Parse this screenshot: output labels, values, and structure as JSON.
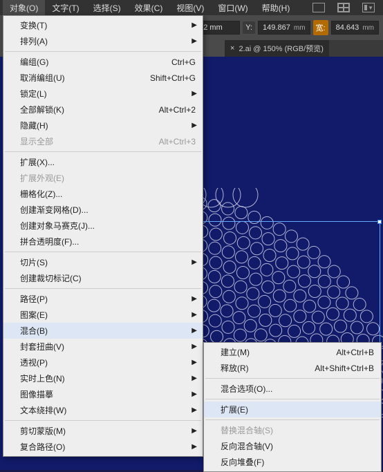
{
  "menubar": {
    "items": [
      "对象(O)",
      "文字(T)",
      "选择(S)",
      "效果(C)",
      "视图(V)",
      "窗口(W)",
      "帮助(H)"
    ]
  },
  "options": {
    "x_suffix": "2 mm",
    "y_label": "Y:",
    "y_value": "149.867",
    "w_label": "宽:",
    "w_value": "84.643",
    "mm": "mm"
  },
  "tabs": {
    "active": {
      "label": "2.ai @ 150% (RGB/预览)",
      "close": "×"
    }
  },
  "menu": {
    "transform": "变换(T)",
    "arrange": "排列(A)",
    "group": "编组(G)",
    "group_sc": "Ctrl+G",
    "ungroup": "取消编组(U)",
    "ungroup_sc": "Shift+Ctrl+G",
    "lock": "锁定(L)",
    "unlockall": "全部解锁(K)",
    "unlockall_sc": "Alt+Ctrl+2",
    "hide": "隐藏(H)",
    "showall": "显示全部",
    "showall_sc": "Alt+Ctrl+3",
    "expand": "扩展(X)...",
    "expandapp": "扩展外观(E)",
    "rasterize": "栅格化(Z)...",
    "gradmesh": "创建渐变网格(D)...",
    "mosaic": "创建对象马赛克(J)...",
    "flatten": "拼合透明度(F)...",
    "slice": "切片(S)",
    "trim": "创建裁切标记(C)",
    "path": "路径(P)",
    "pattern": "图案(E)",
    "blend": "混合(B)",
    "envelope": "封套扭曲(V)",
    "perspective": "透视(P)",
    "livepaint": "实时上色(N)",
    "imgtrace": "图像描摹",
    "textwrap": "文本绕排(W)",
    "clip": "剪切蒙版(M)",
    "compound": "复合路径(O)"
  },
  "submenu": {
    "make": "建立(M)",
    "make_sc": "Alt+Ctrl+B",
    "release": "释放(R)",
    "release_sc": "Alt+Shift+Ctrl+B",
    "opts": "混合选项(O)...",
    "expand": "扩展(E)",
    "replace": "替换混合轴(S)",
    "reverse": "反向混合轴(V)",
    "frontback": "反向堆叠(F)"
  }
}
